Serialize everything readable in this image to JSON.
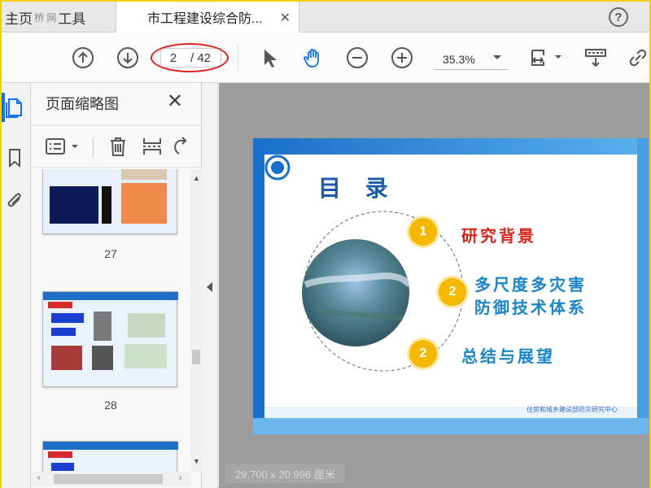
{
  "tabs": {
    "home_label": "主页",
    "tools_label": "工具",
    "document_label": "市工程建设综合防...",
    "watermark": "桥 网"
  },
  "toolbar": {
    "current_page": "2",
    "total_pages": "/ 42",
    "zoom": "35.3%"
  },
  "thumbnail_panel": {
    "title": "页面缩略图",
    "pages": [
      {
        "label": "27"
      },
      {
        "label": "28"
      }
    ]
  },
  "slide": {
    "title": "目 录",
    "items": [
      {
        "number": "1",
        "text": "研究背景",
        "color": "#d9261c"
      },
      {
        "number": "2",
        "text_line1": "多尺度多灾害",
        "text_line2": "防御技术体系",
        "color": "#1a86c8"
      },
      {
        "number": "2",
        "text": "总结与展望",
        "color": "#1a86c8"
      }
    ],
    "footer": "住房和城乡建设部防灾研究中心"
  },
  "status": {
    "page_size": "29.700 x 20.996 厘米"
  },
  "colors": {
    "accent": "#1473e6",
    "annotation": "#e02020",
    "badge": "#f5b800"
  }
}
